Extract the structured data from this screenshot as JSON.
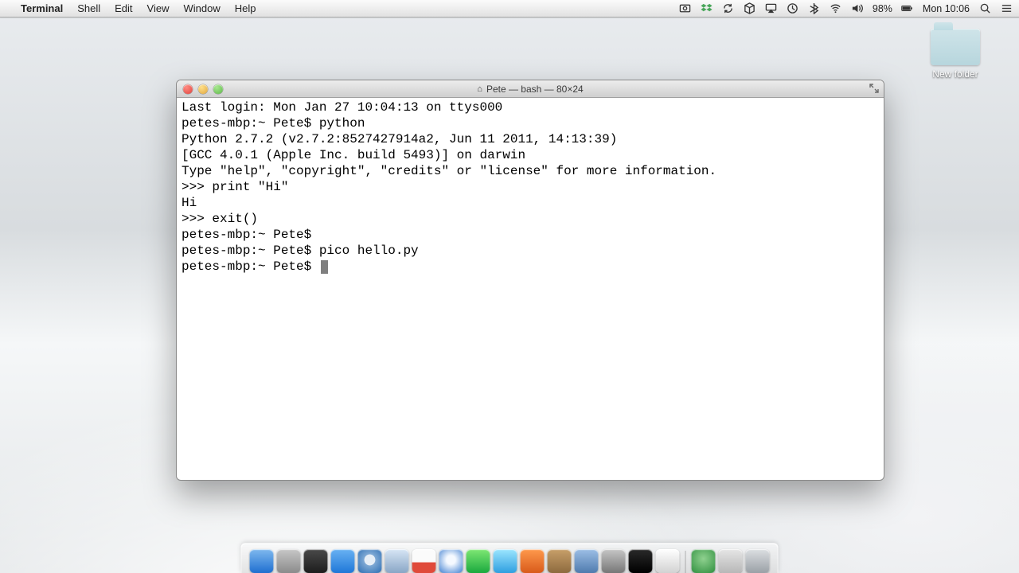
{
  "menubar": {
    "app": "Terminal",
    "items": [
      "Shell",
      "Edit",
      "View",
      "Window",
      "Help"
    ],
    "battery": "98%",
    "clock": "Mon 10:06"
  },
  "desktop": {
    "folder_label": "New folder"
  },
  "window": {
    "title": "Pete — bash — 80×24"
  },
  "terminal": {
    "lines": [
      "Last login: Mon Jan 27 10:04:13 on ttys000",
      "petes-mbp:~ Pete$ python",
      "Python 2.7.2 (v2.7.2:8527427914a2, Jun 11 2011, 14:13:39) ",
      "[GCC 4.0.1 (Apple Inc. build 5493)] on darwin",
      "Type \"help\", \"copyright\", \"credits\" or \"license\" for more information.",
      ">>> print \"Hi\"",
      "Hi",
      ">>> exit()",
      "petes-mbp:~ Pete$ ",
      "petes-mbp:~ Pete$ pico hello.py",
      "petes-mbp:~ Pete$ "
    ]
  },
  "dock": {
    "items": [
      {
        "name": "finder",
        "bg": "linear-gradient(#7fb9ef,#1f6fd0)"
      },
      {
        "name": "launchpad",
        "bg": "linear-gradient(#c7c7c7,#8b8b8b)"
      },
      {
        "name": "mission-control",
        "bg": "linear-gradient(#4a4a4a,#1d1d1d)"
      },
      {
        "name": "app-store",
        "bg": "linear-gradient(#69b2f3,#1f77d8)"
      },
      {
        "name": "safari",
        "bg": "radial-gradient(circle at 50% 45%,#e6eef6 30%,#7fa9d4 32%,#2b6db3)"
      },
      {
        "name": "mail",
        "bg": "linear-gradient(#d7e6f5,#89a6c6)"
      },
      {
        "name": "ical",
        "bg": "linear-gradient(#fbfbfb 55%,#e04a3a 56%)"
      },
      {
        "name": "itunes",
        "bg": "radial-gradient(circle at 50% 45%,#f5f9ff 25%,#3e7fd1)"
      },
      {
        "name": "facetime",
        "bg": "linear-gradient(#7fe874,#1aa93e)"
      },
      {
        "name": "ichat",
        "bg": "linear-gradient(#9de6ff,#2e9fe0)"
      },
      {
        "name": "photo-booth",
        "bg": "linear-gradient(#ff9a4d,#d85a1a)"
      },
      {
        "name": "contacts",
        "bg": "linear-gradient(#c8a06a,#8d6a3e)"
      },
      {
        "name": "preview",
        "bg": "linear-gradient(#9dbfe6,#4f7bae)"
      },
      {
        "name": "system-preferences",
        "bg": "linear-gradient(#c6c6c6,#777)"
      },
      {
        "name": "terminal",
        "bg": "linear-gradient(#2a2a2a,#000)"
      },
      {
        "name": "textedit",
        "bg": "linear-gradient(#fff,#d2d2d2)"
      }
    ],
    "after_sep": [
      {
        "name": "downloads",
        "bg": "radial-gradient(circle at 50% 40%,#8fd18f,#2f8f3f)"
      },
      {
        "name": "documents",
        "bg": "linear-gradient(#e6e6e6,#b7b7b7)"
      },
      {
        "name": "trash",
        "bg": "linear-gradient(#dcdfe2,#9aa0a6)"
      }
    ]
  }
}
